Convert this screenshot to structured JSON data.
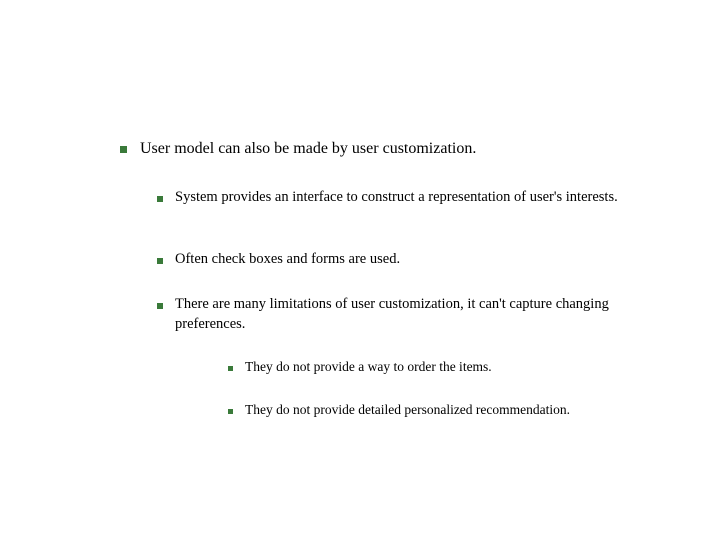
{
  "bullet_color": "#3a7a3a",
  "main": {
    "text": "User model can also be made by user customization."
  },
  "sub": [
    {
      "text": "System provides an interface to construct a representation of user's interests."
    },
    {
      "text": "Often check boxes and forms are used."
    },
    {
      "text": "There are many limitations of user customization, it can't capture changing preferences."
    }
  ],
  "subsub": [
    {
      "text": "They do not provide a way to order the items."
    },
    {
      "text": "They do not provide detailed personalized recommendation."
    }
  ]
}
